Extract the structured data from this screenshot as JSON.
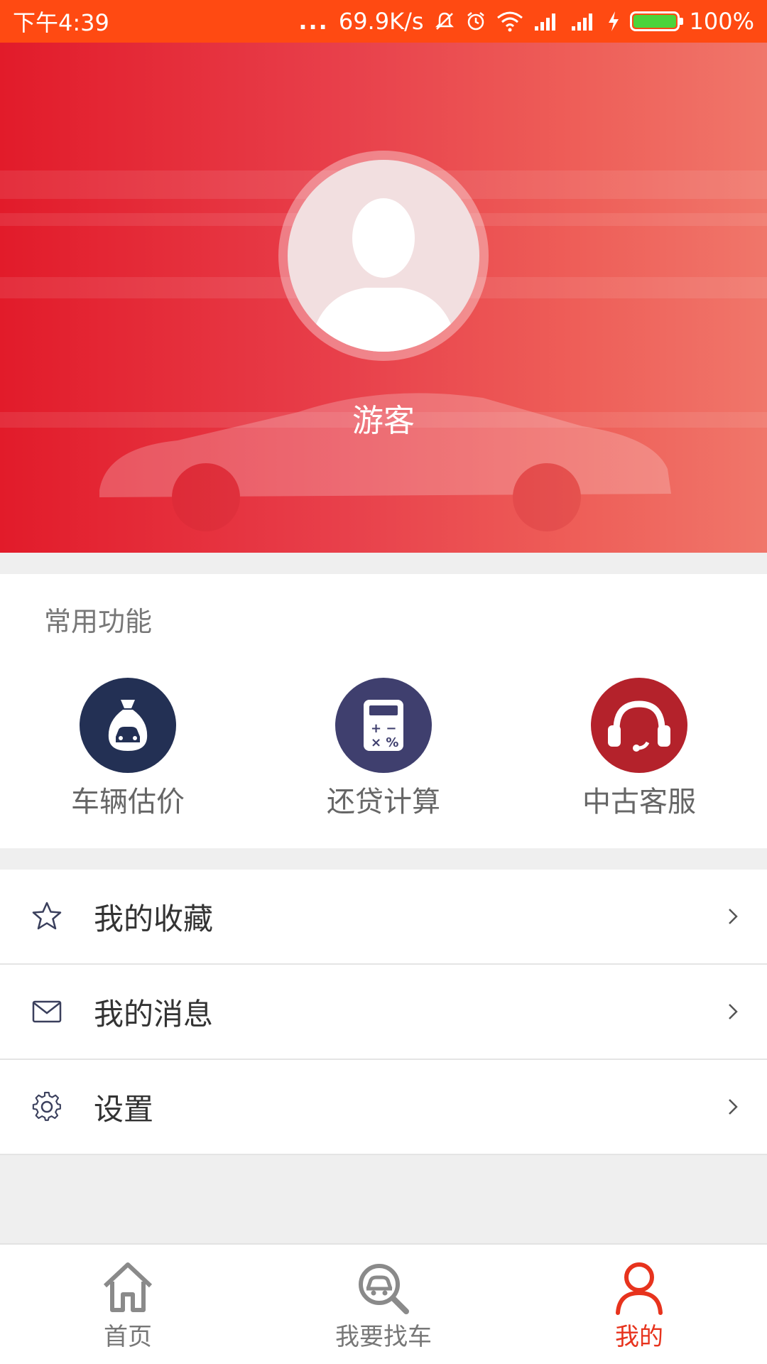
{
  "status_bar": {
    "time": "下午4:39",
    "dots": "...",
    "network_speed": "69.9K/s",
    "battery": "100%",
    "battery_level": 1.0,
    "icons": [
      "notification-muted-icon",
      "alarm-icon",
      "wifi-icon",
      "signal-icon",
      "signal-icon",
      "charging-icon",
      "battery-icon"
    ]
  },
  "profile": {
    "username": "游客",
    "avatar_icon": "default-avatar-icon"
  },
  "common_functions": {
    "title": "常用功能",
    "items": [
      {
        "label": "车辆估价",
        "icon": "money-bag-car-icon",
        "color": "#233054"
      },
      {
        "label": "还贷计算",
        "icon": "calculator-icon",
        "color": "#3f3f6e"
      },
      {
        "label": "中古客服",
        "icon": "headset-icon",
        "color": "#b4222b"
      }
    ]
  },
  "menu": {
    "items": [
      {
        "label": "我的收藏",
        "icon": "star-icon"
      },
      {
        "label": "我的消息",
        "icon": "mail-icon"
      },
      {
        "label": "设置",
        "icon": "gear-icon"
      }
    ]
  },
  "bottom_nav": {
    "items": [
      {
        "label": "首页",
        "icon": "home-icon",
        "active": false
      },
      {
        "label": "我要找车",
        "icon": "car-search-icon",
        "active": false
      },
      {
        "label": "我的",
        "icon": "user-icon",
        "active": true
      }
    ]
  },
  "colors": {
    "status_bar": "#ff4a12",
    "accent": "#e7331d",
    "header_gradient_start": "#e21b2a",
    "header_gradient_end": "#f0766a"
  }
}
